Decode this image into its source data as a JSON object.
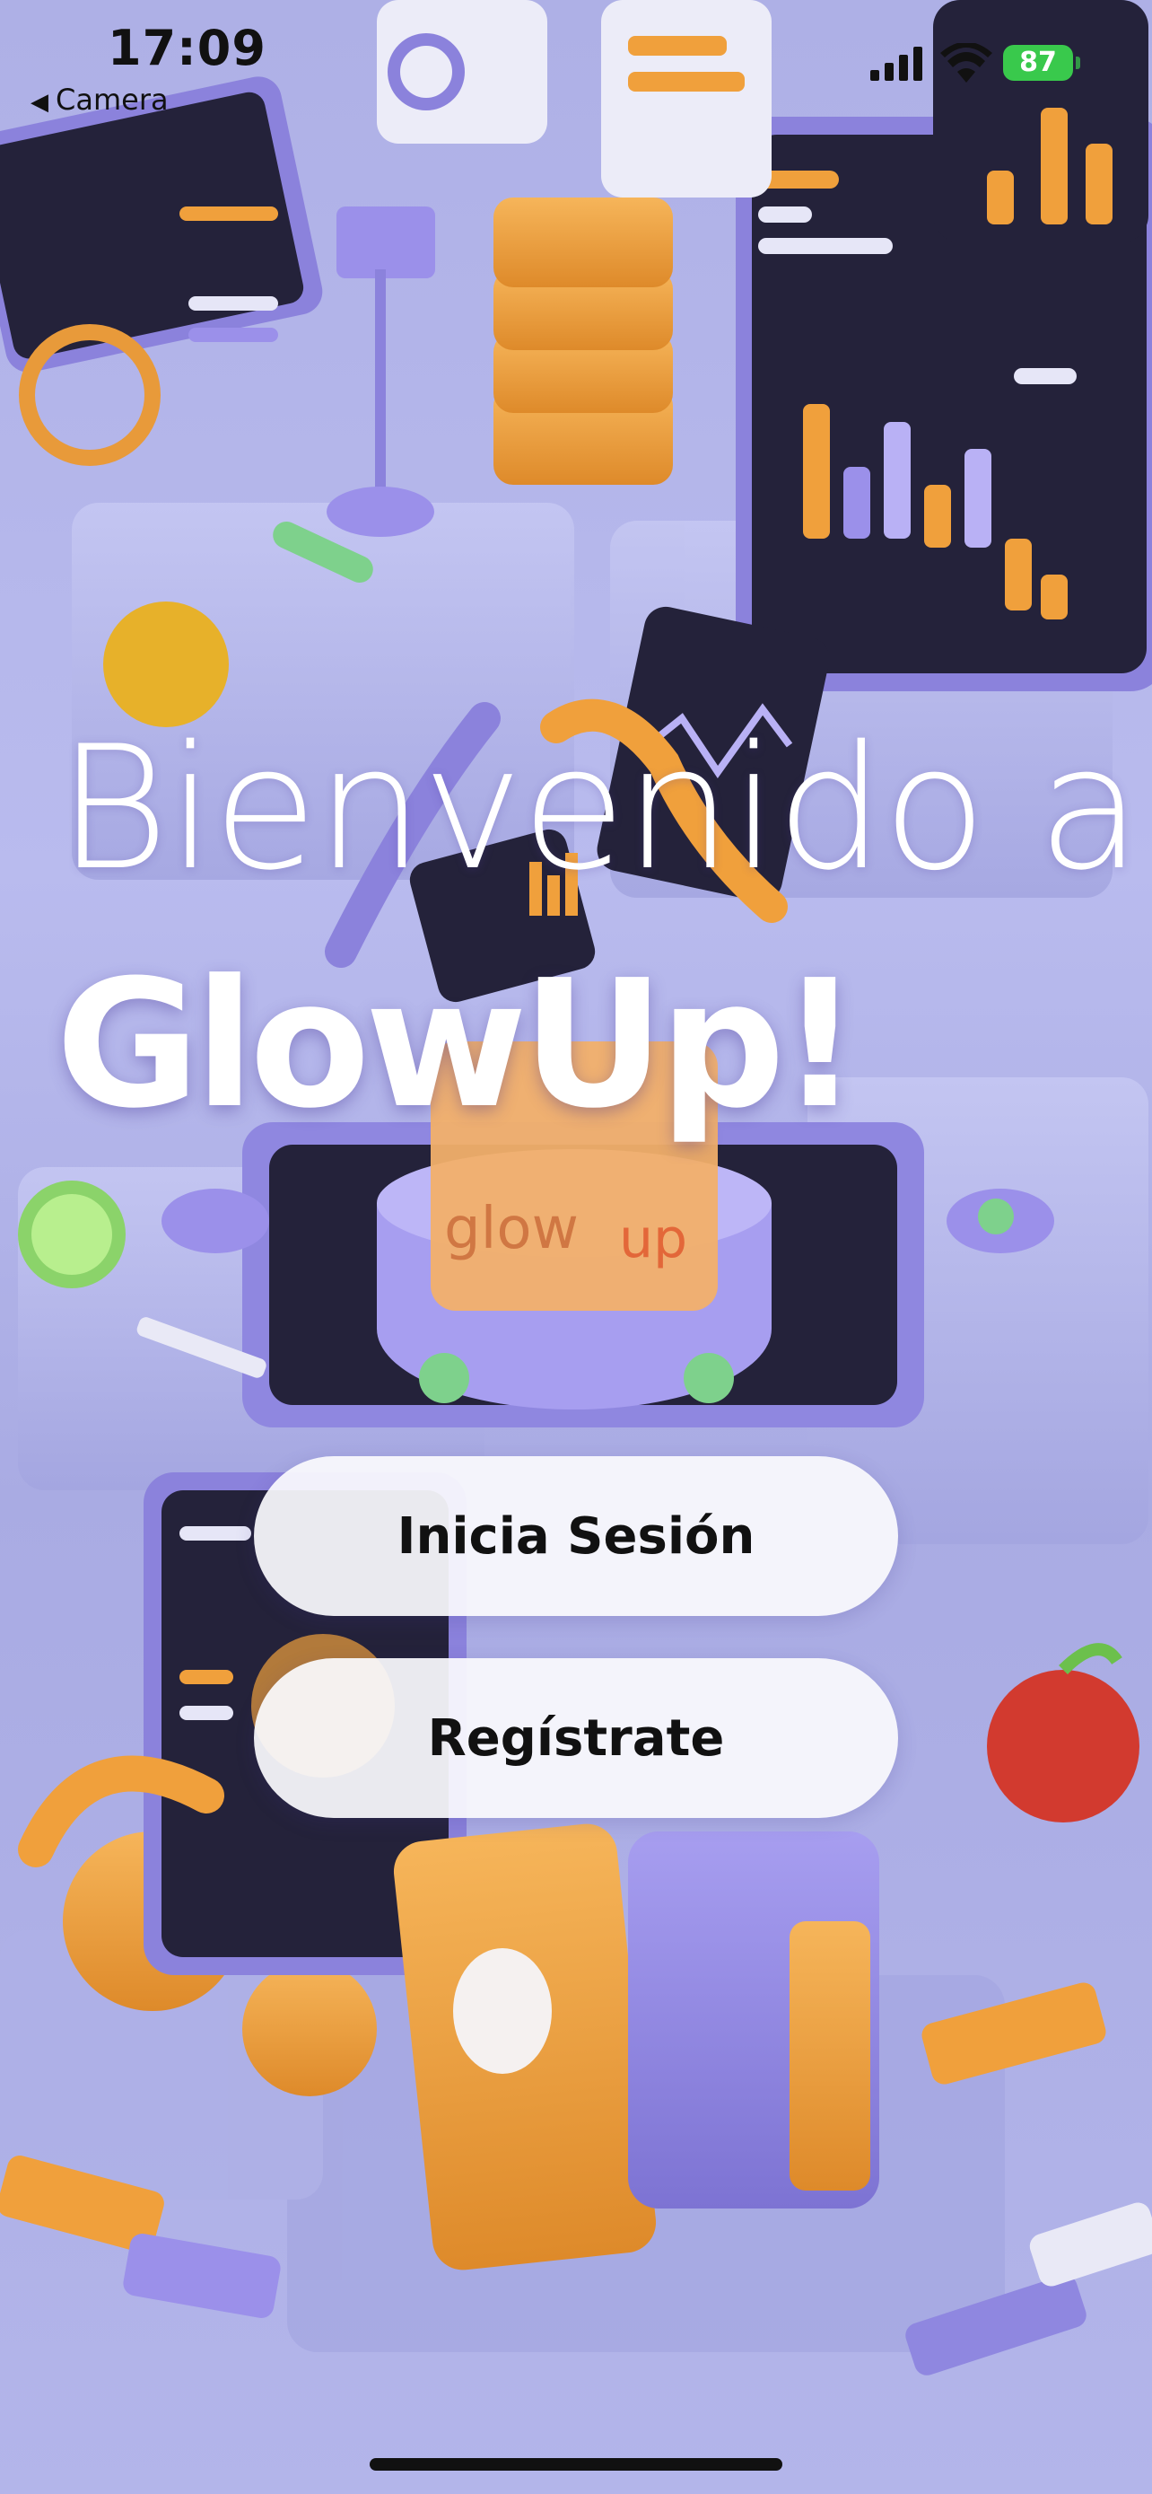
{
  "status_bar": {
    "time": "17:09",
    "back_label": "Camera",
    "battery_level": "87"
  },
  "hero": {
    "line1": "Bienvenido a",
    "line2": "GlowUp!"
  },
  "actions": {
    "login_label": "Inicia Sesión",
    "register_label": "Regístrate"
  },
  "colors": {
    "background": "#b7b9ea",
    "accent_orange": "#f0a03c",
    "accent_purple": "#8f87e0",
    "battery": "#39c94c"
  }
}
